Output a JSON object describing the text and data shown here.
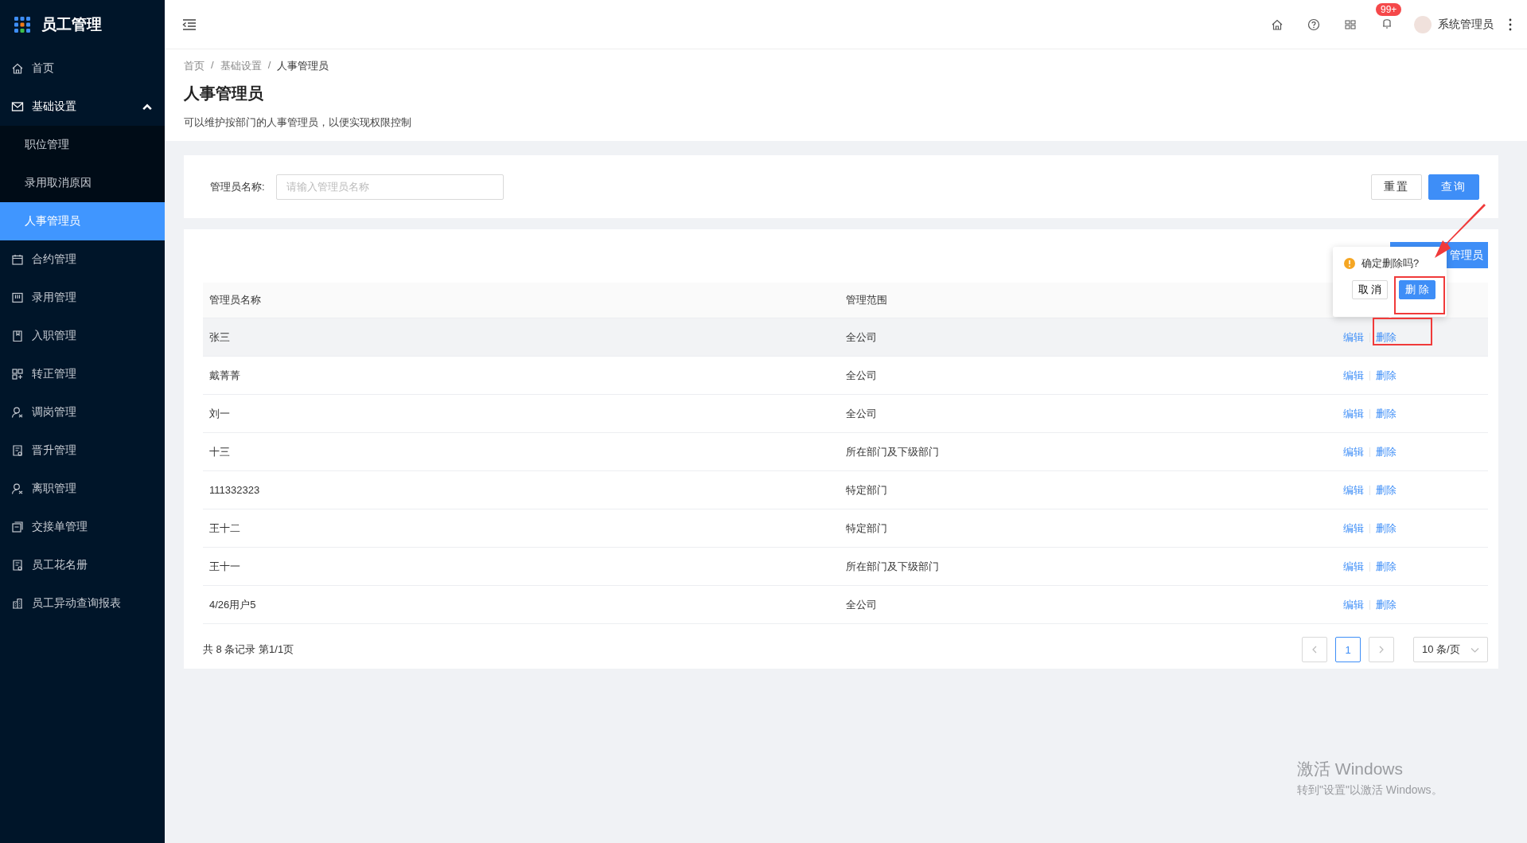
{
  "app": {
    "title": "员工管理"
  },
  "sidebar": {
    "items": [
      {
        "label": "首页",
        "selected": false
      },
      {
        "label": "基础设置",
        "selected": false,
        "expanded": true,
        "children": [
          {
            "label": "职位管理",
            "selected": false
          },
          {
            "label": "录用取消原因",
            "selected": false
          },
          {
            "label": "人事管理员",
            "selected": true
          }
        ]
      },
      {
        "label": "合约管理",
        "selected": false
      },
      {
        "label": "录用管理",
        "selected": false
      },
      {
        "label": "入职管理",
        "selected": false
      },
      {
        "label": "转正管理",
        "selected": false
      },
      {
        "label": "调岗管理",
        "selected": false
      },
      {
        "label": "晋升管理",
        "selected": false
      },
      {
        "label": "离职管理",
        "selected": false
      },
      {
        "label": "交接单管理",
        "selected": false
      },
      {
        "label": "员工花名册",
        "selected": false
      },
      {
        "label": "员工异动查询报表",
        "selected": false
      }
    ]
  },
  "topbar": {
    "badge": "99+",
    "user": "系统管理员"
  },
  "breadcrumb": {
    "separator": "/",
    "items": [
      "首页",
      "基础设置",
      "人事管理员"
    ]
  },
  "page": {
    "title": "人事管理员",
    "description": "可以维护按部门的人事管理员，以便实现权限控制"
  },
  "search": {
    "label": "管理员名称:",
    "placeholder": "请输入管理员名称",
    "buttons": [
      "重置",
      "查询"
    ]
  },
  "toolbar": {
    "add_button": "管理员"
  },
  "popconfirm": {
    "message": "确定删除吗?",
    "cancel": "取 消",
    "confirm": "删 除"
  },
  "table": {
    "columns": [
      "管理员名称",
      "管理范围"
    ],
    "rows": [
      {
        "name": "张三",
        "scope": "全公司",
        "actions": [
          "编辑",
          "删除"
        ],
        "hovered": true
      },
      {
        "name": "戴菁菁",
        "scope": "全公司",
        "actions": [
          "编辑",
          "删除"
        ],
        "hovered": false
      },
      {
        "name": "刘一",
        "scope": "全公司",
        "actions": [
          "编辑",
          "删除"
        ],
        "hovered": false
      },
      {
        "name": "十三",
        "scope": "所在部门及下级部门",
        "actions": [
          "编辑",
          "删除"
        ],
        "hovered": false
      },
      {
        "name": "111332323",
        "scope": "特定部门",
        "actions": [
          "编辑",
          "删除"
        ],
        "hovered": false
      },
      {
        "name": "王十二",
        "scope": "特定部门",
        "actions": [
          "编辑",
          "删除"
        ],
        "hovered": false
      },
      {
        "name": "王十一",
        "scope": "所在部门及下级部门",
        "actions": [
          "编辑",
          "删除"
        ],
        "hovered": false
      },
      {
        "name": "4/26用户5",
        "scope": "全公司",
        "actions": [
          "编辑",
          "删除"
        ],
        "hovered": false
      }
    ]
  },
  "pagination": {
    "summary": "共 8 条记录 第1/1页",
    "pages": [
      {
        "label": "1",
        "selected": true
      }
    ],
    "page_size": "10 条/页"
  },
  "os_notice": {
    "title": "激活 Windows",
    "subtitle": "转到\"设置\"以激活 Windows。"
  }
}
